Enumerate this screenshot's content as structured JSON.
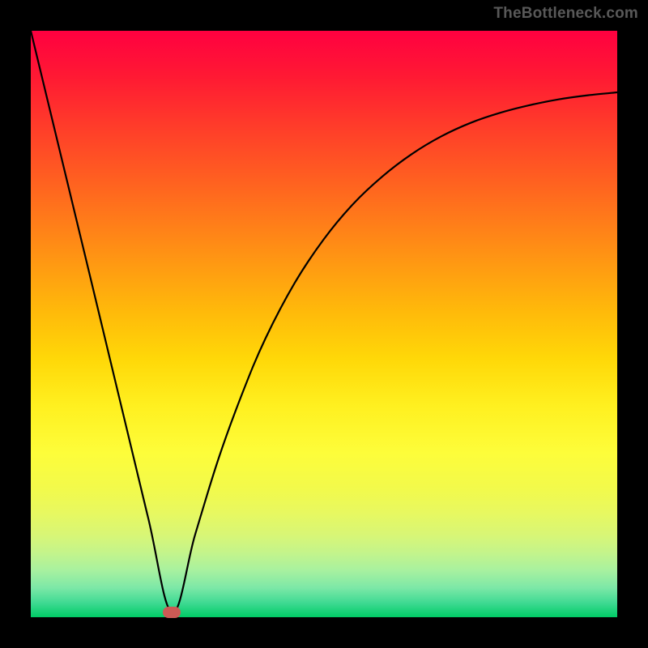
{
  "attribution": "TheBottleneck.com",
  "colors": {
    "background": "#000000",
    "curve": "#000000",
    "marker": "#cc5a55",
    "gradient_top": "#ff0040",
    "gradient_bottom": "#00cc66"
  },
  "marker": {
    "x_frac": 0.241,
    "y_frac": 0.992
  },
  "chart_data": {
    "type": "line",
    "title": "",
    "xlabel": "",
    "ylabel": "",
    "xlim": [
      0,
      100
    ],
    "ylim": [
      0,
      100
    ],
    "x": [
      0,
      5,
      10,
      15,
      20,
      24.1,
      28,
      32,
      36,
      40,
      45,
      50,
      55,
      60,
      65,
      70,
      75,
      80,
      85,
      90,
      95,
      100
    ],
    "values": [
      100,
      79.3,
      58.6,
      37.8,
      17.0,
      0.8,
      14.0,
      27.0,
      38.0,
      47.5,
      57.0,
      64.5,
      70.5,
      75.2,
      79.0,
      82.0,
      84.3,
      86.0,
      87.3,
      88.3,
      89.0,
      89.5
    ],
    "series": [
      {
        "name": "curve",
        "values": [
          100,
          79.3,
          58.6,
          37.8,
          17.0,
          0.8,
          14.0,
          27.0,
          38.0,
          47.5,
          57.0,
          64.5,
          70.5,
          75.2,
          79.0,
          82.0,
          84.3,
          86.0,
          87.3,
          88.3,
          89.0,
          89.5
        ]
      }
    ],
    "annotations": [
      {
        "type": "marker",
        "x": 24.1,
        "y": 0.8,
        "label": ""
      }
    ]
  }
}
